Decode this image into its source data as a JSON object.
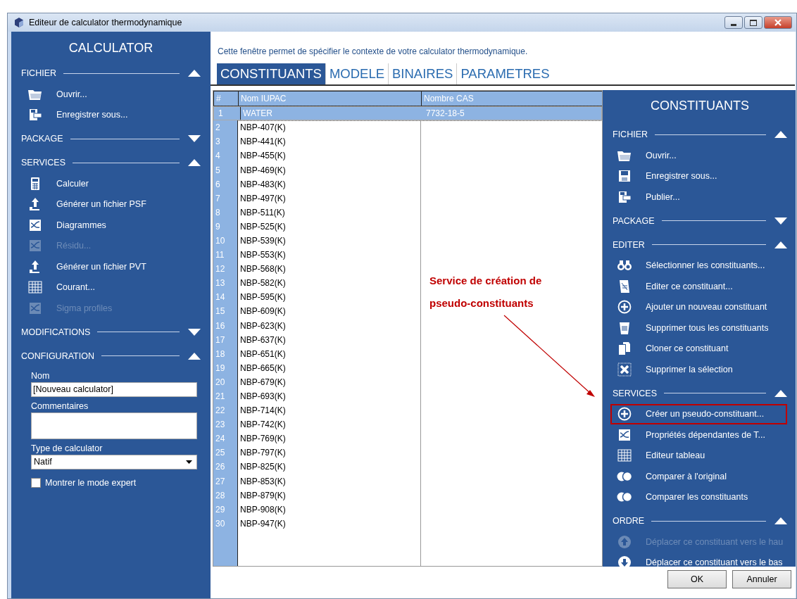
{
  "window": {
    "title": "Editeur de calculator thermodynamique"
  },
  "left_panel": {
    "title": "CALCULATOR",
    "sections": [
      {
        "title": "FICHIER",
        "expanded": true,
        "items": [
          {
            "label": "Ouvrir...",
            "disabled": false
          },
          {
            "label": "Enregistrer sous...",
            "disabled": false
          }
        ]
      },
      {
        "title": "PACKAGE",
        "expanded": false
      },
      {
        "title": "SERVICES",
        "expanded": true,
        "items": [
          {
            "label": "Calculer",
            "disabled": false
          },
          {
            "label": "Générer un fichier PSF",
            "disabled": false
          },
          {
            "label": "Diagrammes",
            "disabled": false
          },
          {
            "label": "Résidu...",
            "disabled": true
          },
          {
            "label": "Générer un fichier PVT",
            "disabled": false
          },
          {
            "label": "Courant...",
            "disabled": false
          },
          {
            "label": "Sigma profiles",
            "disabled": true
          }
        ]
      },
      {
        "title": "MODIFICATIONS",
        "expanded": false
      },
      {
        "title": "CONFIGURATION",
        "expanded": true,
        "form": {
          "name_label": "Nom",
          "name_value": "[Nouveau calculator]",
          "comments_label": "Commentaires",
          "type_label": "Type de calculator",
          "type_value": "Natif",
          "expert_label": "Montrer le mode expert",
          "expert_checked": false
        }
      }
    ]
  },
  "description": "Cette fenêtre permet de spécifier le contexte de votre calculator thermodynamique.",
  "tabs": [
    {
      "label": "CONSTITUANTS",
      "selected": true
    },
    {
      "label": "MODELE",
      "selected": false
    },
    {
      "label": "BINAIRES",
      "selected": false
    },
    {
      "label": "PARAMETRES",
      "selected": false
    }
  ],
  "table": {
    "columns": [
      "#",
      "Nom IUPAC",
      "Nombre CAS"
    ],
    "rows": [
      {
        "n": "1",
        "name": "WATER",
        "cas": "7732-18-5",
        "selected": true
      },
      {
        "n": "2",
        "name": "NBP-407(K)",
        "selected": false
      },
      {
        "n": "3",
        "name": "NBP-441(K)",
        "selected": false
      },
      {
        "n": "4",
        "name": "NBP-455(K)",
        "selected": false
      },
      {
        "n": "5",
        "name": "NBP-469(K)",
        "selected": false
      },
      {
        "n": "6",
        "name": "NBP-483(K)",
        "selected": false
      },
      {
        "n": "7",
        "name": "NBP-497(K)",
        "selected": false
      },
      {
        "n": "8",
        "name": "NBP-511(K)",
        "selected": false
      },
      {
        "n": "9",
        "name": "NBP-525(K)",
        "selected": false
      },
      {
        "n": "10",
        "name": "NBP-539(K)",
        "selected": false
      },
      {
        "n": "11",
        "name": "NBP-553(K)",
        "selected": false
      },
      {
        "n": "12",
        "name": "NBP-568(K)",
        "selected": false
      },
      {
        "n": "13",
        "name": "NBP-582(K)",
        "selected": false
      },
      {
        "n": "14",
        "name": "NBP-595(K)",
        "selected": false
      },
      {
        "n": "15",
        "name": "NBP-609(K)",
        "selected": false
      },
      {
        "n": "16",
        "name": "NBP-623(K)",
        "selected": false
      },
      {
        "n": "17",
        "name": "NBP-637(K)",
        "selected": false
      },
      {
        "n": "18",
        "name": "NBP-651(K)",
        "selected": false
      },
      {
        "n": "19",
        "name": "NBP-665(K)",
        "selected": false
      },
      {
        "n": "20",
        "name": "NBP-679(K)",
        "selected": false
      },
      {
        "n": "21",
        "name": "NBP-693(K)",
        "selected": false
      },
      {
        "n": "22",
        "name": "NBP-714(K)",
        "selected": false
      },
      {
        "n": "23",
        "name": "NBP-742(K)",
        "selected": false
      },
      {
        "n": "24",
        "name": "NBP-769(K)",
        "selected": false
      },
      {
        "n": "25",
        "name": "NBP-797(K)",
        "selected": false
      },
      {
        "n": "26",
        "name": "NBP-825(K)",
        "selected": false
      },
      {
        "n": "27",
        "name": "NBP-853(K)",
        "selected": false
      },
      {
        "n": "28",
        "name": "NBP-879(K)",
        "selected": false
      },
      {
        "n": "29",
        "name": "NBP-908(K)",
        "selected": false
      },
      {
        "n": "30",
        "name": "NBP-947(K)",
        "selected": false
      }
    ]
  },
  "right_panel": {
    "title": "CONSTITUANTS",
    "sections": [
      {
        "title": "FICHIER",
        "expanded": true,
        "items": [
          {
            "label": "Ouvrir...",
            "disabled": false,
            "highlighted": false
          },
          {
            "label": "Enregistrer sous...",
            "disabled": false,
            "highlighted": false
          },
          {
            "label": "Publier...",
            "disabled": false,
            "highlighted": false
          }
        ]
      },
      {
        "title": "PACKAGE",
        "expanded": false
      },
      {
        "title": "EDITER",
        "expanded": true,
        "items": [
          {
            "label": "Sélectionner les constituants...",
            "disabled": false,
            "highlighted": false
          },
          {
            "label": "Editer ce constituant...",
            "disabled": false,
            "highlighted": false
          },
          {
            "label": "Ajouter un nouveau constituant",
            "disabled": false,
            "highlighted": false
          },
          {
            "label": "Supprimer tous les constituants",
            "disabled": false,
            "highlighted": false
          },
          {
            "label": "Cloner ce constituant",
            "disabled": false,
            "highlighted": false
          },
          {
            "label": "Supprimer la sélection",
            "disabled": false,
            "highlighted": false
          }
        ]
      },
      {
        "title": "SERVICES",
        "expanded": true,
        "items": [
          {
            "label": "Créer un pseudo-constituant...",
            "disabled": false,
            "highlighted": true
          },
          {
            "label": "Propriétés dépendantes de T...",
            "disabled": false,
            "highlighted": false
          },
          {
            "label": "Editeur tableau",
            "disabled": false,
            "highlighted": false
          },
          {
            "label": "Comparer à l'original",
            "disabled": false,
            "highlighted": false
          },
          {
            "label": "Comparer les constituants",
            "disabled": false,
            "highlighted": false
          }
        ]
      },
      {
        "title": "ORDRE",
        "expanded": true,
        "items": [
          {
            "label": "Déplacer ce constituant vers le hau",
            "disabled": true,
            "highlighted": false
          },
          {
            "label": "Déplacer ce constituant vers le bas",
            "disabled": false,
            "highlighted": false
          }
        ]
      }
    ]
  },
  "annotation": {
    "lines": [
      "Service de création de",
      "pseudo-constituants"
    ]
  },
  "buttons": [
    "OK",
    "Annuler"
  ]
}
